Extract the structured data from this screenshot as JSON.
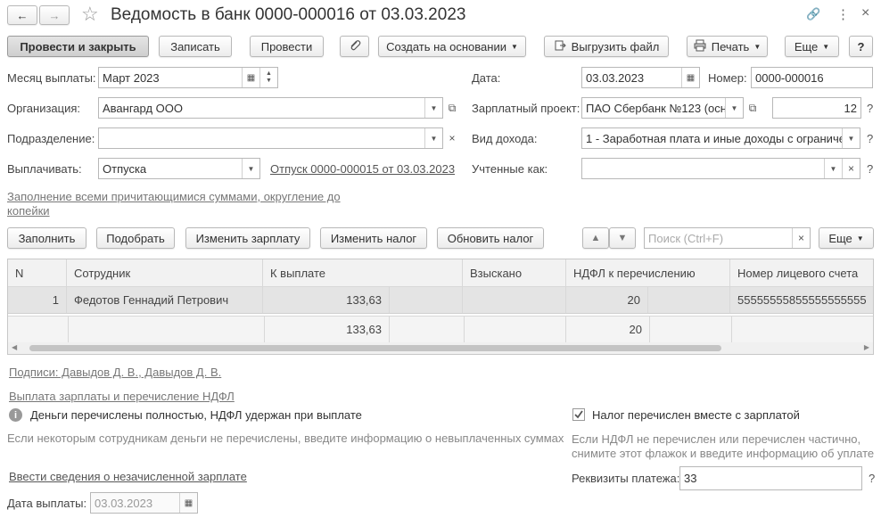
{
  "window": {
    "title": "Ведомость в банк 0000-000016 от 03.03.2023"
  },
  "nav": {
    "back": "←",
    "forward": "→",
    "star": "☆"
  },
  "win_icons": {
    "link": "🔗",
    "more": "⋮",
    "close": "×"
  },
  "toolbar": {
    "post_close": "Провести и закрыть",
    "write": "Записать",
    "post": "Провести",
    "create_based": "Создать на основании",
    "export_file": "Выгрузить файл",
    "print": "Печать",
    "more": "Еще",
    "help": "?"
  },
  "form": {
    "month_label": "Месяц выплаты:",
    "month_value": "Март 2023",
    "org_label": "Организация:",
    "org_value": "Авангард ООО",
    "dept_label": "Подразделение:",
    "dept_value": "",
    "pay_label": "Выплачивать:",
    "pay_value": "Отпуска",
    "pay_link": "Отпуск 0000-000015 от 03.03.2023",
    "date_label": "Дата:",
    "date_value": "03.03.2023",
    "number_label": "Номер:",
    "number_value": "0000-000016",
    "project_label": "Зарплатный проект:",
    "project_value": "ПАО Сбербанк №123 (осн",
    "project_num": "12",
    "income_label": "Вид дохода:",
    "income_value": "1 - Заработная плата и иные доходы с ограниче",
    "counted_label": "Учтенные как:",
    "counted_value": "",
    "fill_link": "Заполнение всеми причитающимися суммами, округление до копейки"
  },
  "table_toolbar": {
    "fill": "Заполнить",
    "pick": "Подобрать",
    "change_salary": "Изменить зарплату",
    "change_tax": "Изменить налог",
    "update_tax": "Обновить налог",
    "search_placeholder": "Поиск (Ctrl+F)",
    "more": "Еще"
  },
  "table": {
    "columns": [
      "N",
      "Сотрудник",
      "К выплате",
      "Взыскано",
      "НДФЛ к перечислению",
      "Номер лицевого счета"
    ],
    "rows": [
      {
        "n": "1",
        "employee": "Федотов Геннадий Петрович",
        "to_pay": "133,63",
        "collected": "",
        "ndfl": "20",
        "account": "55555555855555555555"
      }
    ],
    "totals": {
      "to_pay": "133,63",
      "ndfl": "20"
    }
  },
  "bottom": {
    "signatures": "Подписи: Давыдов Д. В., Давыдов Д. В.",
    "payout_link": "Выплата зарплаты и перечисление НДФЛ",
    "info_text": "Деньги перечислены  полностью, НДФЛ удержан при выплате",
    "hint_left": "Если некоторым сотрудникам деньги не перечислены, введите информацию о невыплаченных суммах",
    "tax_checkbox": "Налог перечислен вместе с зарплатой",
    "hint_right1": "Если НДФЛ не перечислен или перечислен частично,",
    "hint_right2": "снимите этот флажок и введите информацию об уплате",
    "unpaid_link": "Ввести сведения о незачисленной зарплате",
    "payment_label": "Реквизиты платежа:",
    "payment_value": "33",
    "pay_date_label": "Дата выплаты:",
    "pay_date_value": "03.03.2023"
  }
}
